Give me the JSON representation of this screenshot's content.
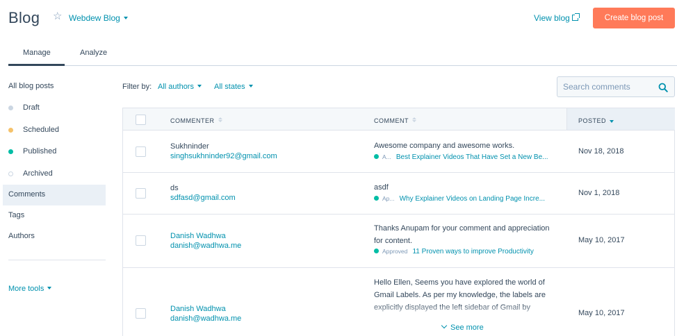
{
  "header": {
    "title": "Blog",
    "blog_selector": "Webdew Blog",
    "view_blog": "View blog",
    "create_button": "Create blog post"
  },
  "tabs": [
    {
      "label": "Manage",
      "active": true
    },
    {
      "label": "Analyze",
      "active": false
    }
  ],
  "sidebar": {
    "all_posts": "All blog posts",
    "states": [
      {
        "label": "Draft",
        "color": "#cbd6e2"
      },
      {
        "label": "Scheduled",
        "color": "#f5c26b"
      },
      {
        "label": "Published",
        "color": "#00bda5"
      },
      {
        "label": "Archived",
        "color": "#ffffff"
      }
    ],
    "comments": "Comments",
    "tags": "Tags",
    "authors": "Authors",
    "more_tools": "More tools"
  },
  "filters": {
    "label": "Filter by:",
    "authors": "All authors",
    "states": "All states",
    "search_placeholder": "Search comments"
  },
  "table": {
    "columns": [
      "COMMENTER",
      "COMMENT",
      "POSTED"
    ],
    "rows": [
      {
        "name": "Sukhninder",
        "email": "singhsukhninder92@gmail.com",
        "comment": "Awesome company and awesome works.",
        "status": "A...",
        "post": "Best Explainer Videos That Have Set a New Be...",
        "date": "Nov 18, 2018"
      },
      {
        "name": "ds",
        "email": "sdfasd@gmail.com",
        "comment": "asdf",
        "status": "Ap...",
        "post": "Why Explainer Videos on Landing Page Incre...",
        "date": "Nov 1, 2018"
      },
      {
        "name": "Danish Wadhwa",
        "email": "danish@wadhwa.me",
        "comment": "Thanks Anupam for your comment and appreciation for content.",
        "status": "Approved",
        "post": "11 Proven ways to improve Productivity",
        "date": "May 10, 2017"
      },
      {
        "name": "Danish Wadhwa",
        "email": "danish@wadhwa.me",
        "comment": "Hello Ellen, Seems you have explored the world of Gmail Labels. As per my knowledge, the labels are explicitly displayed the left sidebar of Gmail by",
        "date": "May 10, 2017"
      }
    ],
    "see_more": "See more"
  }
}
